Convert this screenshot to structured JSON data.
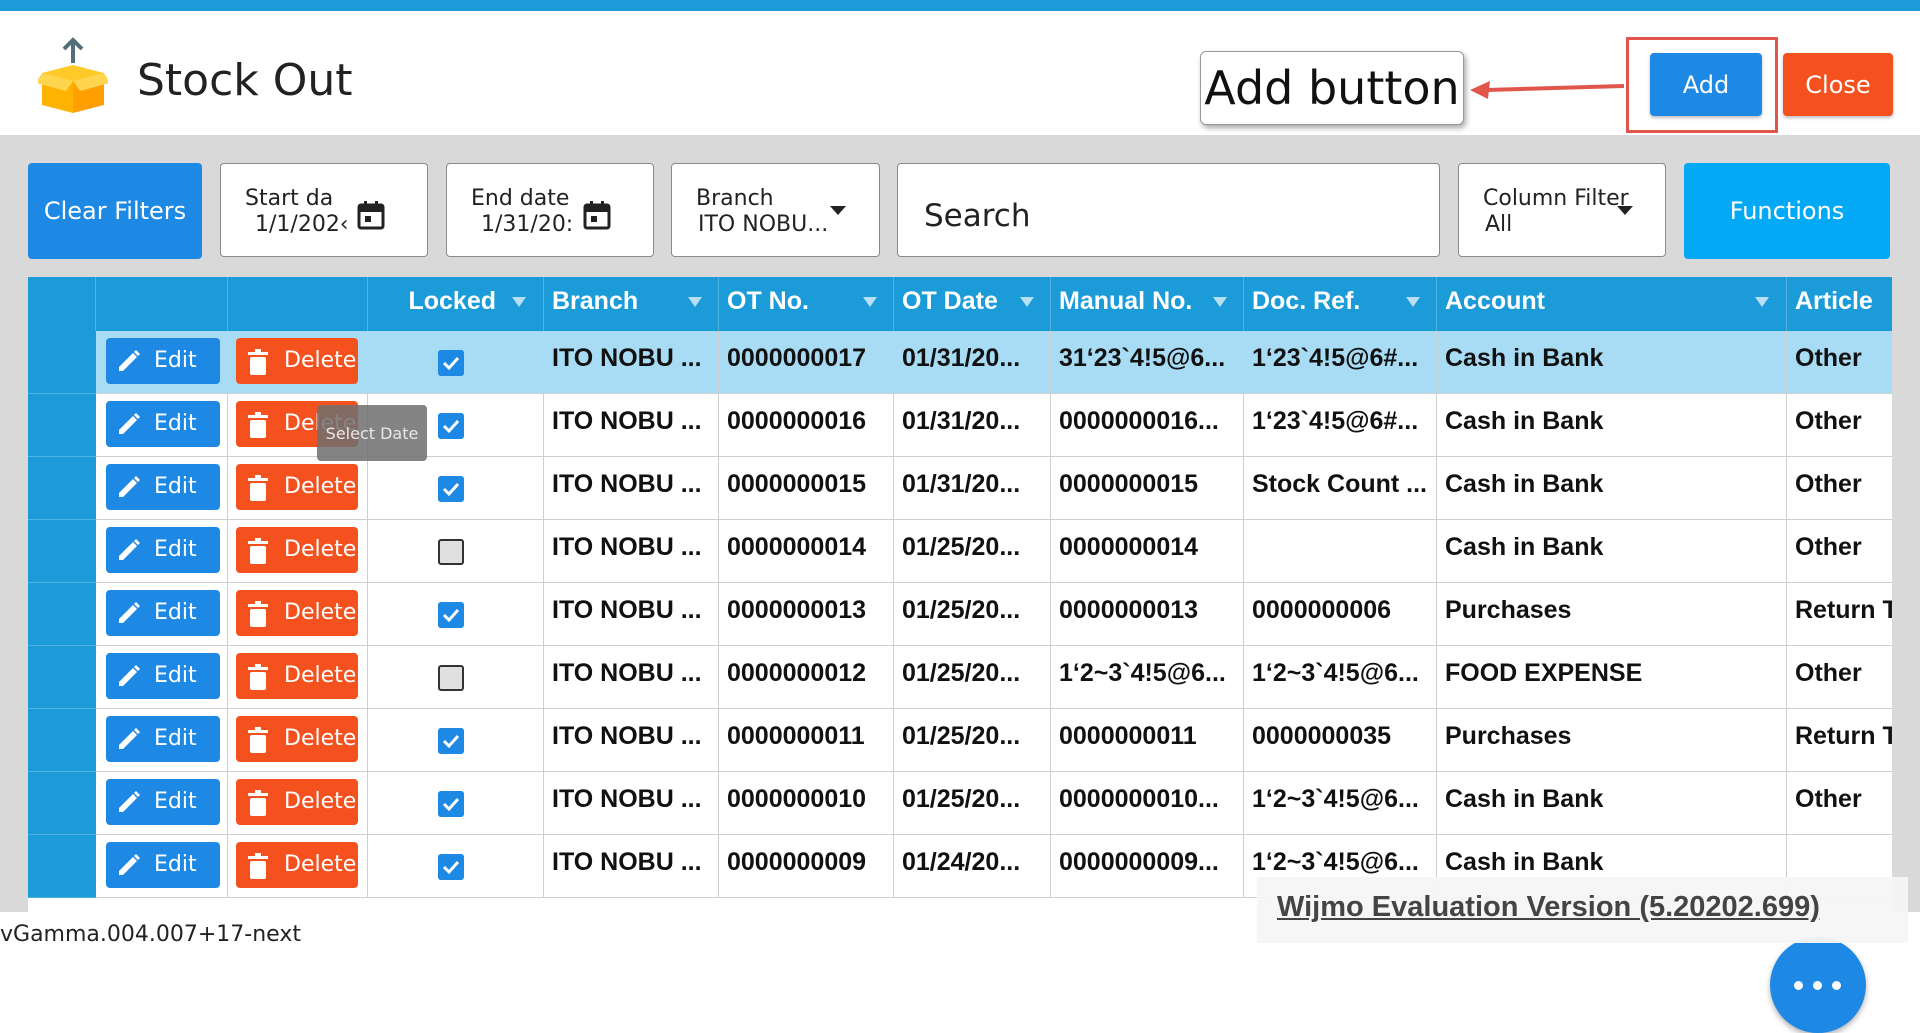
{
  "header": {
    "title": "Stock Out",
    "app_icon": "box-upload-icon",
    "callout": "Add button",
    "add_label": "Add",
    "close_label": "Close"
  },
  "filters": {
    "clear_label": "Clear Filters",
    "start_date": {
      "label": "Start da",
      "value": "1/1/202‹"
    },
    "end_date": {
      "label": "End date",
      "value": "1/31/20:"
    },
    "branch": {
      "label": "Branch",
      "value": "ITO NOBU..."
    },
    "search": {
      "value": "Search"
    },
    "column_filter": {
      "label": "Column Filter",
      "value": "All"
    },
    "functions_label": "Functions"
  },
  "tooltip": "Select Date",
  "grid": {
    "columns": [
      "Locked",
      "Branch",
      "OT No.",
      "OT Date",
      "Manual No.",
      "Doc. Ref.",
      "Account",
      "Article"
    ],
    "edit_label": "Edit",
    "delete_label": "Delete",
    "rows": [
      {
        "locked": true,
        "branch": "ITO NOBU ...",
        "ot_no": "0000000017",
        "ot_date": "01/31/20...",
        "manual_no": "31‘23`4!5@6...",
        "doc_ref": "1‘23`4!5@6#...",
        "account": "Cash in Bank",
        "article": "Other",
        "selected": true
      },
      {
        "locked": true,
        "branch": "ITO NOBU ...",
        "ot_no": "0000000016",
        "ot_date": "01/31/20...",
        "manual_no": "0000000016...",
        "doc_ref": "1‘23`4!5@6#...",
        "account": "Cash in Bank",
        "article": "Other"
      },
      {
        "locked": true,
        "branch": "ITO NOBU ...",
        "ot_no": "0000000015",
        "ot_date": "01/31/20...",
        "manual_no": "0000000015",
        "doc_ref": "Stock Count ...",
        "account": "Cash in Bank",
        "article": "Other"
      },
      {
        "locked": false,
        "branch": "ITO NOBU ...",
        "ot_no": "0000000014",
        "ot_date": "01/25/20...",
        "manual_no": "0000000014",
        "doc_ref": "",
        "account": "Cash in Bank",
        "article": "Other"
      },
      {
        "locked": true,
        "branch": "ITO NOBU ...",
        "ot_no": "0000000013",
        "ot_date": "01/25/20...",
        "manual_no": "0000000013",
        "doc_ref": "0000000006",
        "account": "Purchases",
        "article": "Return T"
      },
      {
        "locked": false,
        "branch": "ITO NOBU ...",
        "ot_no": "0000000012",
        "ot_date": "01/25/20...",
        "manual_no": "1‘2~3`4!5@6...",
        "doc_ref": "1‘2~3`4!5@6...",
        "account": "FOOD EXPENSE",
        "article": "Other"
      },
      {
        "locked": true,
        "branch": "ITO NOBU ...",
        "ot_no": "0000000011",
        "ot_date": "01/25/20...",
        "manual_no": "0000000011",
        "doc_ref": "0000000035",
        "account": "Purchases",
        "article": "Return T"
      },
      {
        "locked": true,
        "branch": "ITO NOBU ...",
        "ot_no": "0000000010",
        "ot_date": "01/25/20...",
        "manual_no": "0000000010...",
        "doc_ref": "1‘2~3`4!5@6...",
        "account": "Cash in Bank",
        "article": "Other"
      },
      {
        "locked": true,
        "branch": "ITO NOBU ...",
        "ot_no": "0000000009",
        "ot_date": "01/24/20...",
        "manual_no": "0000000009...",
        "doc_ref": "1‘2~3`4!5@6...",
        "account": "Cash in Bank",
        "article": ""
      }
    ]
  },
  "footer": {
    "version": "vGamma.004.007+17-next",
    "wijmo": "Wijmo Evaluation Version (5.20202.699)"
  },
  "colors": {
    "accent": "#1b9bd7",
    "primary_button": "#1e88e5",
    "danger_button": "#f4511e",
    "functions_button": "#03a9f4",
    "selected_row": "#a8dbf4"
  }
}
